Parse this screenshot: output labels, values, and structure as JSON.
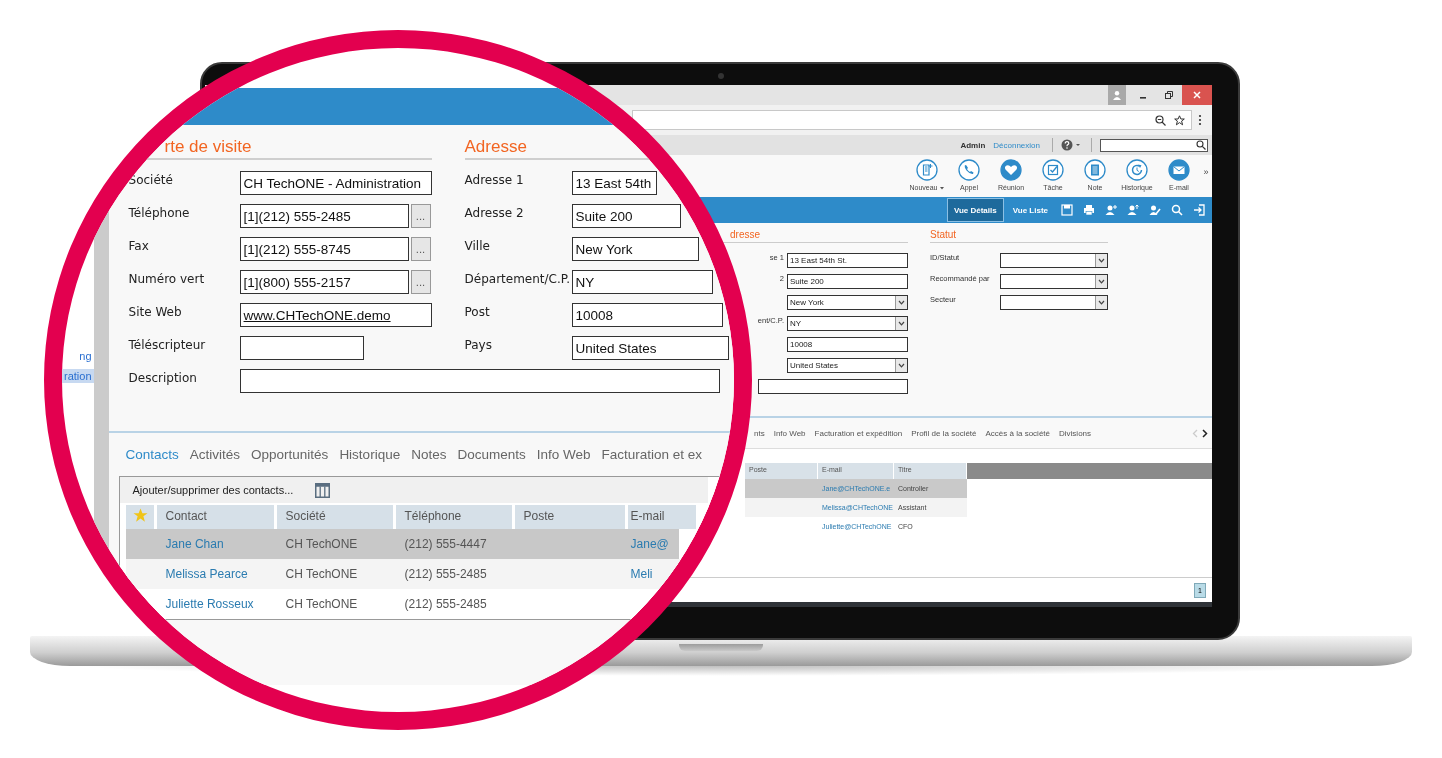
{
  "app_header": {
    "user": "Admin",
    "logout": "Déconnexion"
  },
  "toolbar": [
    {
      "label": "Nouveau",
      "has_menu": true
    },
    {
      "label": "Appel",
      "has_menu": false
    },
    {
      "label": "Réunion",
      "has_menu": false
    },
    {
      "label": "Tâche",
      "has_menu": false
    },
    {
      "label": "Note",
      "has_menu": false
    },
    {
      "label": "Historique",
      "has_menu": false
    },
    {
      "label": "E-mail",
      "has_menu": false
    }
  ],
  "toolbar_more": "»",
  "view_bar": {
    "views": [
      {
        "label": "Vue Détails",
        "selected": true
      },
      {
        "label": "Vue Liste",
        "selected": false
      }
    ]
  },
  "address_section": {
    "heading": "dresse",
    "fields": [
      {
        "kind": "text",
        "label": "se 1",
        "value": "13 East 54th St."
      },
      {
        "kind": "text",
        "label": "2",
        "value": "Suite 200"
      },
      {
        "kind": "select",
        "value": "New York"
      },
      {
        "kind": "select",
        "label": "ent/C.P.",
        "value": "NY"
      },
      {
        "kind": "text",
        "value": "10008"
      },
      {
        "kind": "select",
        "value": "United States"
      },
      {
        "kind": "wide"
      }
    ]
  },
  "status_section": {
    "heading": "Statut",
    "fields": [
      {
        "kind": "select",
        "label": "ID/Statut"
      },
      {
        "kind": "select",
        "label": "Recommandé par"
      },
      {
        "kind": "select",
        "label": "Secteur"
      }
    ]
  },
  "tabs": [
    "nts",
    "Info Web",
    "Facturation et expédition",
    "Profil de la société",
    "Accès à la société",
    "Divisions"
  ],
  "grid": {
    "columns": [
      "Poste",
      "E-mail",
      "Titre"
    ],
    "rows": [
      {
        "selected": true,
        "email": "Jane@CHTechONE.e",
        "title": "Controller"
      },
      {
        "selected": false,
        "email": "Melissa@CHTechONE",
        "title": "Assistant"
      },
      {
        "selected": false,
        "email": "Juliette@CHTechONE",
        "title": "CFO"
      }
    ]
  },
  "pager": {
    "page": "1"
  },
  "lens": {
    "sidebar": [
      {
        "label": "ng",
        "selected": false
      },
      {
        "label": "ration",
        "selected": true
      }
    ],
    "business_card": {
      "heading": "rte de visite",
      "fields": [
        {
          "kind": "text",
          "label": "Société",
          "value": "CH TechONE - Administration"
        },
        {
          "kind": "phone",
          "label": "Téléphone",
          "value": "[1](212) 555-2485",
          "action": "..."
        },
        {
          "kind": "phone",
          "label": "Fax",
          "value": "[1](212) 555-8745",
          "action": "..."
        },
        {
          "kind": "phone",
          "label": "Numéro vert",
          "value": "[1](800) 555-2157",
          "action": "..."
        },
        {
          "kind": "link",
          "label": "Site Web",
          "value": "www.CHTechONE.demo"
        },
        {
          "kind": "short",
          "label": "Téléscripteur"
        }
      ]
    },
    "description": {
      "label": "Description"
    },
    "address": {
      "heading": "Adresse",
      "fields": [
        {
          "label": "Adresse 1",
          "value": "13 East 54th"
        },
        {
          "label": "Adresse 2",
          "value": "Suite 200"
        },
        {
          "label": "Ville",
          "value": "New York"
        },
        {
          "label": "Département/C.P.",
          "value": "NY"
        },
        {
          "label": "Post",
          "value": "10008"
        },
        {
          "label": "Pays",
          "value": "United States"
        }
      ]
    },
    "tabs": [
      {
        "label": "Contacts",
        "selected": true
      },
      {
        "label": "Activités",
        "selected": false
      },
      {
        "label": "Opportunités",
        "selected": false
      },
      {
        "label": "Historique",
        "selected": false
      },
      {
        "label": "Notes",
        "selected": false
      },
      {
        "label": "Documents",
        "selected": false
      },
      {
        "label": "Info Web",
        "selected": false
      },
      {
        "label": "Facturation et ex",
        "selected": false
      }
    ],
    "contacts": {
      "toolbar": "Ajouter/supprimer des contacts...",
      "columns": [
        "Contact",
        "Société",
        "Téléphone",
        "Poste",
        "E-mail"
      ],
      "rows": [
        {
          "selected": true,
          "contact": "Jane Chan",
          "company": "CH TechONE",
          "phone": "(212) 555-4447",
          "email": "Jane@"
        },
        {
          "selected": false,
          "contact": "Melissa Pearce",
          "company": "CH TechONE",
          "phone": "(212) 555-2485",
          "email": "Meli"
        },
        {
          "selected": false,
          "contact": "Juliette Rosseux",
          "company": "CH TechONE",
          "phone": "(212) 555-2485"
        }
      ]
    }
  }
}
